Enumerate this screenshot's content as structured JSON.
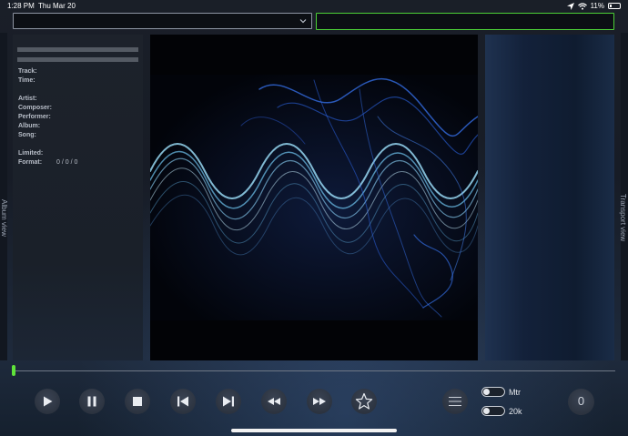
{
  "status_bar": {
    "time": "1:28 PM",
    "date": "Thu Mar 20",
    "battery": "11%"
  },
  "top": {
    "select_value": "",
    "field_value": ""
  },
  "sidebars": {
    "left_label": "Album view",
    "right_label": "Transport view"
  },
  "info": {
    "track_label": "Track:",
    "time_label": "Time:",
    "artist_label": "Artist:",
    "composer_label": "Composer:",
    "performer_label": "Performer:",
    "album_label": "Album:",
    "song_label": "Song:",
    "limited_label": "Limited:",
    "format_label": "Format:",
    "format_value": "0 / 0 / 0"
  },
  "playback": {
    "progress": 0.0
  },
  "toggles": {
    "mtr_label": "Mtr",
    "rate_label": "20k"
  },
  "counter": {
    "value": "0"
  },
  "colors": {
    "accent_green": "#4cd137",
    "wave_blue": "#3a7bff",
    "wave_cyan": "#9fe3ff"
  },
  "icons": [
    "play-icon",
    "pause-icon",
    "stop-icon",
    "previous-track-icon",
    "next-track-icon",
    "rewind-icon",
    "fast-forward-icon",
    "star-icon",
    "menu-icon",
    "location-icon",
    "wifi-icon",
    "battery-icon",
    "chevron-down-icon"
  ]
}
